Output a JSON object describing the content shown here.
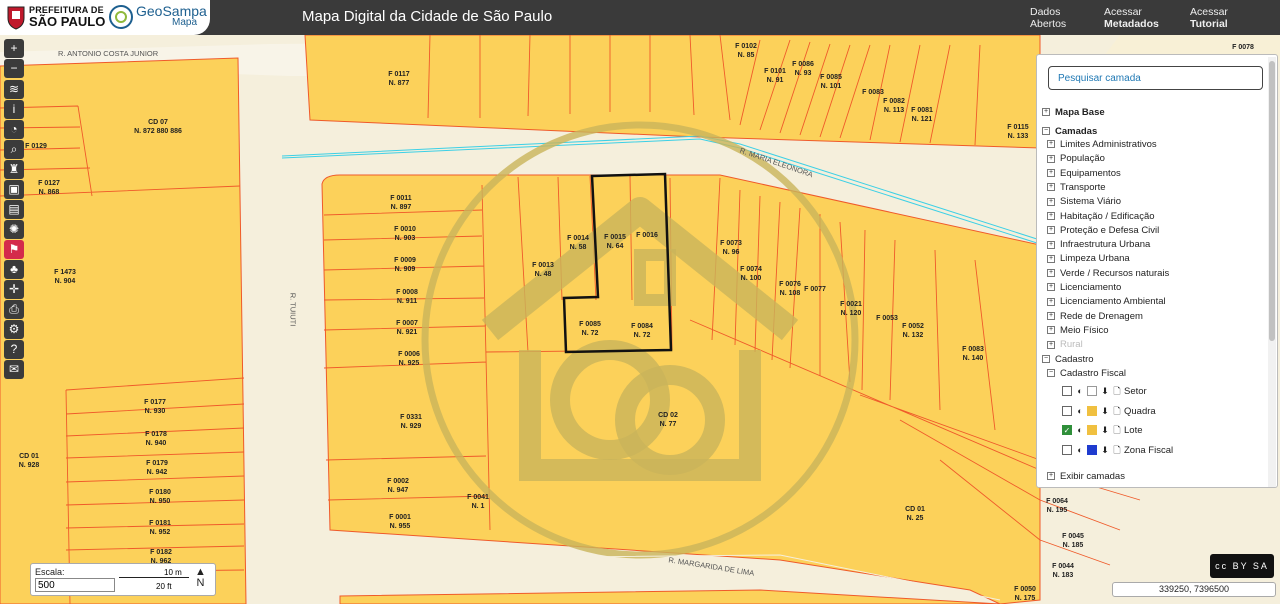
{
  "header": {
    "prefeitura_line1": "PREFEITURA DE",
    "prefeitura_line2": "SÃO PAULO",
    "geosampa_name": "GeoSampa",
    "geosampa_sub": "Mapa",
    "title": "Mapa Digital da Cidade de São Paulo",
    "links": [
      {
        "line1": "Dados",
        "line2": "Abertos"
      },
      {
        "line1": "Acessar",
        "line2": "Metadados"
      },
      {
        "line1": "Acessar",
        "line2": "Tutorial"
      }
    ]
  },
  "toolbar": {
    "icons": [
      "zoom-in-icon",
      "zoom-out-icon",
      "layers-icon",
      "info-icon",
      "measure-icon",
      "search-icon",
      "street-view-icon",
      "save-icon",
      "print-map-icon",
      "network-icon",
      "map-share-icon",
      "tree-icon",
      "crosshair-icon",
      "printer-icon",
      "settings-icon",
      "help-icon",
      "email-icon"
    ]
  },
  "layer_panel": {
    "search_placeholder": "Pesquisar camada",
    "mapa_base": "Mapa Base",
    "camadas": "Camadas",
    "groups": [
      "Limites Administrativos",
      "População",
      "Equipamentos",
      "Transporte",
      "Sistema Viário",
      "Habitação / Edificação",
      "Proteção e Defesa Civil",
      "Infraestrutura Urbana",
      "Limpeza Urbana",
      "Verde / Recursos naturais",
      "Licenciamento",
      "Licenciamento Ambiental",
      "Rede de Drenagem",
      "Meio Físico",
      "Rural"
    ],
    "cadastro": "Cadastro",
    "cadastro_fiscal": "Cadastro Fiscal",
    "layers": [
      {
        "name": "Setor",
        "checked": false,
        "swatch": "#ffffff"
      },
      {
        "name": "Quadra",
        "checked": false,
        "swatch": "#f0c040"
      },
      {
        "name": "Lote",
        "checked": true,
        "swatch": "#f0c040"
      },
      {
        "name": "Zona Fiscal",
        "checked": false,
        "swatch": "#1f3ccf"
      }
    ],
    "exibir_camadas": "Exibir camadas"
  },
  "streets": [
    "R. ANTONIO COSTA JUNIOR",
    "R. MARIA ELEONORA",
    "R. TUIUTI",
    "R. MARGARIDA DE LIMA"
  ],
  "lots": [
    {
      "code": "F 0117",
      "num": "N. 877"
    },
    {
      "code": "CD 07",
      "num": "N. 872 880 886"
    },
    {
      "code": "F 0127",
      "num": "N. 868"
    },
    {
      "code": "F 0129",
      "num": ""
    },
    {
      "code": "F 1473",
      "num": "N. 904"
    },
    {
      "code": "F 0011",
      "num": "N. 897"
    },
    {
      "code": "F 0010",
      "num": "N. 903"
    },
    {
      "code": "F 0009",
      "num": "N. 909"
    },
    {
      "code": "F 0008",
      "num": "N. 911"
    },
    {
      "code": "F 0007",
      "num": "N. 921"
    },
    {
      "code": "F 0006",
      "num": "N. 925"
    },
    {
      "code": "F 0331",
      "num": "N. 929"
    },
    {
      "code": "F 0002",
      "num": "N. 947"
    },
    {
      "code": "F 0001",
      "num": "N. 955"
    },
    {
      "code": "F 0041",
      "num": "N. 1"
    },
    {
      "code": "F 0013",
      "num": "N. 48"
    },
    {
      "code": "F 0014",
      "num": "N. 58"
    },
    {
      "code": "F 0015",
      "num": "N. 64"
    },
    {
      "code": "F 0016",
      "num": ""
    },
    {
      "code": "F 0085",
      "num": "N. 72"
    },
    {
      "code": "F 0084",
      "num": "N. 72"
    },
    {
      "code": "F 0073",
      "num": "N. 96"
    },
    {
      "code": "F 0074",
      "num": "N. 100"
    },
    {
      "code": "F 0076",
      "num": "N. 108"
    },
    {
      "code": "F 0077",
      "num": ""
    },
    {
      "code": "F 0021",
      "num": "N. 120"
    },
    {
      "code": "F 0053",
      "num": ""
    },
    {
      "code": "F 0052",
      "num": "N. 132"
    },
    {
      "code": "F 0083",
      "num": "N. 140"
    },
    {
      "code": "CD 02",
      "num": "N. 77"
    },
    {
      "code": "CD 01",
      "num": "N. 25"
    },
    {
      "code": "CD 01",
      "num": "N. 928"
    },
    {
      "code": "F 0177",
      "num": "N. 930"
    },
    {
      "code": "F 0178",
      "num": "N. 940"
    },
    {
      "code": "F 0179",
      "num": "N. 942"
    },
    {
      "code": "F 0180",
      "num": "N. 950"
    },
    {
      "code": "F 0181",
      "num": "N. 952"
    },
    {
      "code": "F 0182",
      "num": "N. 962"
    },
    {
      "code": "F 0102",
      "num": "N. 85"
    },
    {
      "code": "F 0101",
      "num": "N. 91"
    },
    {
      "code": "F 0086",
      "num": "N. 93"
    },
    {
      "code": "F 0085",
      "num": "N. 101"
    },
    {
      "code": "F 0083",
      "num": ""
    },
    {
      "code": "F 0082",
      "num": "N. 113"
    },
    {
      "code": "F 0081",
      "num": "N. 121"
    },
    {
      "code": "F 0115",
      "num": "N. 133"
    },
    {
      "code": "F 0064",
      "num": "N. 195"
    },
    {
      "code": "F 0045",
      "num": "N. 185"
    },
    {
      "code": "F 0044",
      "num": "N. 183"
    },
    {
      "code": "F 0050",
      "num": "N. 175"
    },
    {
      "code": "F 0078",
      "num": ""
    }
  ],
  "scale": {
    "label": "Escala:",
    "value": "500",
    "meters": "10 m",
    "feet": "20 ft",
    "north": "N"
  },
  "coordinates": "339250, 7396500",
  "license": "cc BY SA"
}
